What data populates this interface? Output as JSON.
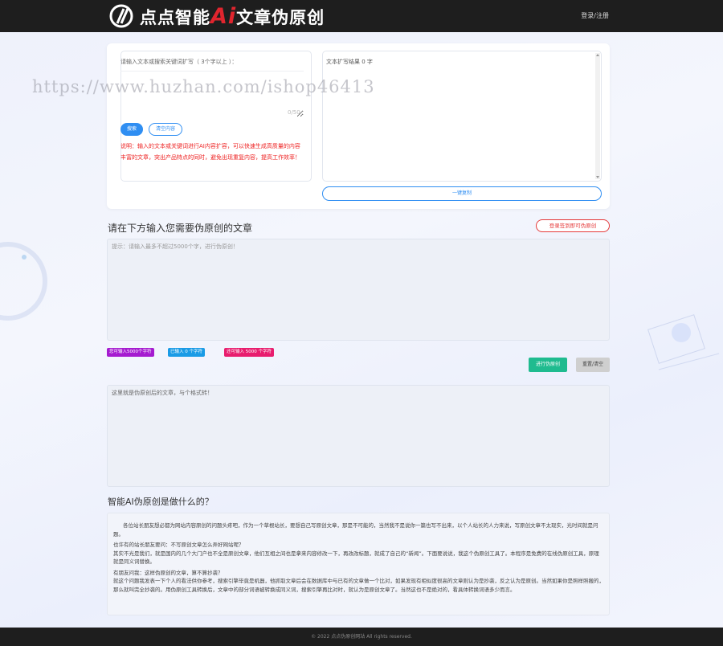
{
  "header": {
    "logo_text_a": "点点智能",
    "logo_text_ai": "Ai",
    "logo_text_b": "文章伪原创",
    "login_link": "登录/注册"
  },
  "watermark": "https://www.huzhan.com/ishop46413",
  "keyword": {
    "label": "请输入文本或搜索关键词扩写（ 3个字以上 ）：",
    "value": "",
    "count": "0/50",
    "expand_button": "搜索",
    "clear_button": "清空内容",
    "note": "说明：输入的文本或关键词进行AI内容扩容，可以快速生成高质量的内容丰富的文章，突出产品特点的同时，避免出现重复内容，提高工作效率！"
  },
  "result": {
    "title": "文本扩写结果 0 字",
    "copy_button": "一键复制"
  },
  "rewrite": {
    "section_title": "请在下方输入您需要伪原创的文章",
    "login_button": "登录签到即可伪原创",
    "input_placeholder": "提示：请输入最多不超过5000个字，进行伪原创！",
    "tag_limit": "您可输入5000个字符",
    "tag_input": "已输入 0 个字符",
    "tag_remain": "还可输入 5000 个字符",
    "start_button": "进行伪原创",
    "reset_button": "重置/清空",
    "output_placeholder": "这里就是伪原创后的文章，与个格式转！"
  },
  "about": {
    "title": "智能AI伪原创是做什么的？",
    "paragraphs": [
      "各位站长朋友想必都为网站内容原创的问题头疼吧，作为一个草根站长，要想自己写原创文章，那是不可能的，当然我不是说你一篇也写不出来，以个人站长的人力来说，写原创文章不太现实，光时间就是问题。",
      "也许有的站长朋友要问：不写原创文章怎么弄好网站呢？\n其实不光是我们，就是国内的几个大门户也不全是原创文章，他们互相之间也是拿来内容修改一下，再改改标题，就成了自己的“新闻”。下面要说说，我这个伪原创工具了。本程序是免费的在线伪原创工具，原理就是同义词替换。",
      "有朋友问我：这样伪原创的文章，算不算抄袭？\n就这个问题我发表一下个人的看法供你参考，搜索引擎毕竟是机器，他抓取文章后会在数据库中与已有的文章做一个比对，如果发现有相似度很高的文章则认为是抄袭，反之认为是原创。当然如果你是照样照搬的，那么就叫完全抄袭的。用伪原创工具转换后，文章中的部分词语被转换成同义词，搜索引擎再比对时，就认为是原创文章了。当然这也不是绝对的，看具体转换词语多少而言。"
    ]
  },
  "footer": "© 2022 点点伪原创网站 All rights reserved."
}
